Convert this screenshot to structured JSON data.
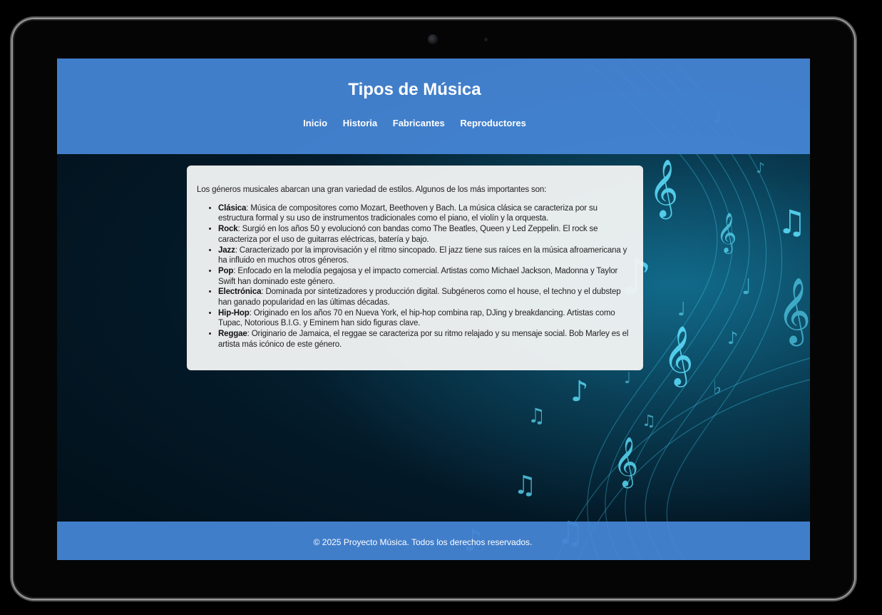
{
  "header": {
    "title": "Tipos de Música",
    "nav": [
      "Inicio",
      "Historia",
      "Fabricantes",
      "Reproductores"
    ]
  },
  "main": {
    "intro": "Los géneros musicales abarcan una gran variedad de estilos. Algunos de los más importantes son:",
    "genres": [
      {
        "name": "Clásica",
        "text": ": Música de compositores como Mozart, Beethoven y Bach. La música clásica se caracteriza por su estructura formal y su uso de instrumentos tradicionales como el piano, el violín y la orquesta."
      },
      {
        "name": "Rock",
        "text": ": Surgió en los años 50 y evolucionó con bandas como The Beatles, Queen y Led Zeppelin. El rock se caracteriza por el uso de guitarras eléctricas, batería y bajo."
      },
      {
        "name": "Jazz",
        "text": ": Caracterizado por la improvisación y el ritmo sincopado. El jazz tiene sus raíces en la música afroamericana y ha influido en muchos otros géneros."
      },
      {
        "name": "Pop",
        "text": ": Enfocado en la melodía pegajosa y el impacto comercial. Artistas como Michael Jackson, Madonna y Taylor Swift han dominado este género."
      },
      {
        "name": "Electrónica",
        "text": ": Dominada por sintetizadores y producción digital. Subgéneros como el house, el techno y el dubstep han ganado popularidad en las últimas décadas."
      },
      {
        "name": "Hip-Hop",
        "text": ": Originado en los años 70 en Nueva York, el hip-hop combina rap, DJing y breakdancing. Artistas como Tupac, Notorious B.I.G. y Eminem han sido figuras clave."
      },
      {
        "name": "Reggae",
        "text": ": Originario de Jamaica, el reggae se caracteriza por su ritmo relajado y su mensaje social. Bob Marley es el artista más icónico de este género."
      }
    ]
  },
  "footer": {
    "text": "© 2025 Proyecto Música. Todos los derechos reservados."
  },
  "colors": {
    "header_bg": "#4687d7",
    "page_bg": "#031826",
    "accent_glow": "#19c8f0"
  }
}
